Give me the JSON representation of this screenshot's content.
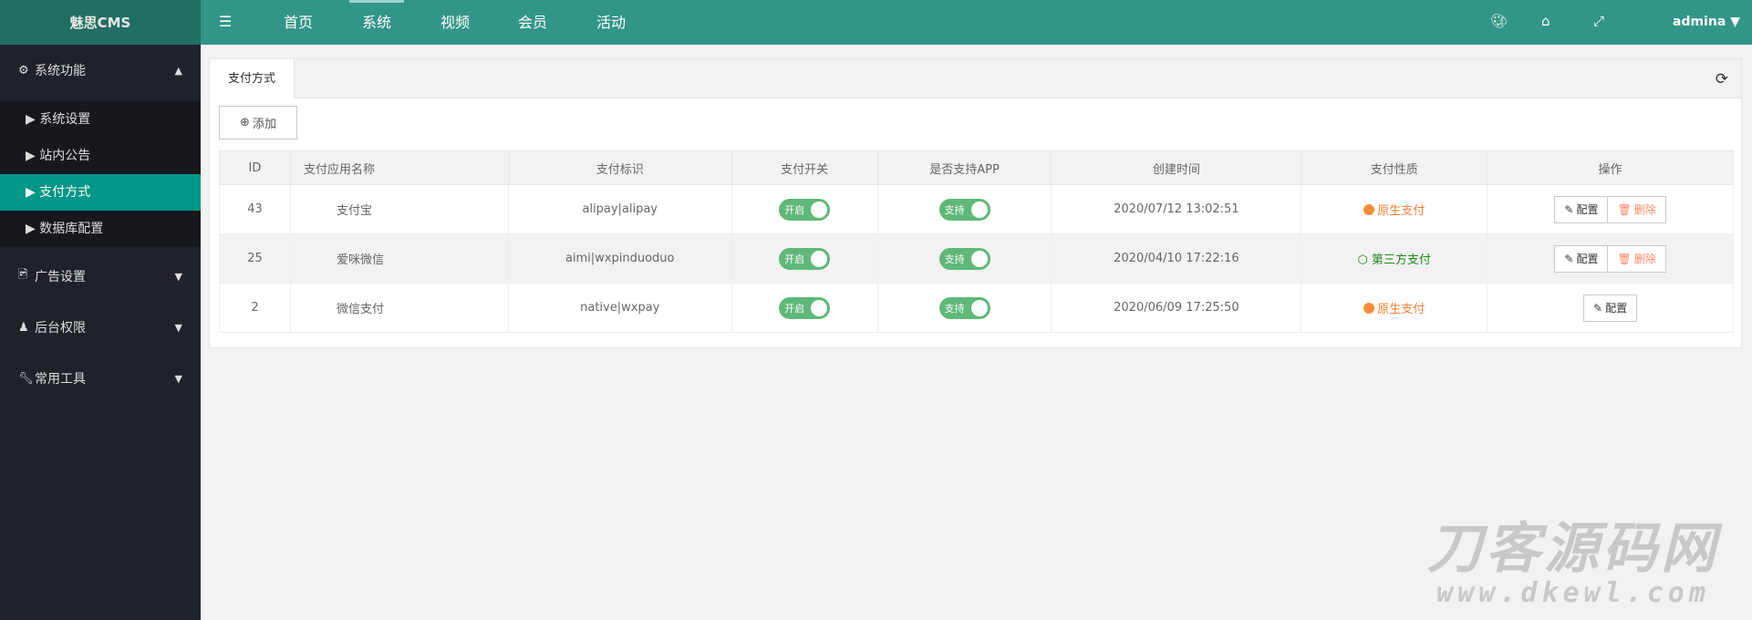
{
  "app": {
    "logo": "魅思CMS"
  },
  "topnav": {
    "items": [
      "首页",
      "系统",
      "视频",
      "会员",
      "活动"
    ],
    "active": "系统",
    "user": "admina",
    "icons": [
      "menu-fold-icon",
      "palette-icon",
      "tag-icon",
      "fullscreen-icon"
    ]
  },
  "sidebar": {
    "groups": [
      {
        "label": "系统功能",
        "icon": "gear-icon",
        "expanded": true
      },
      {
        "label": "广告设置",
        "icon": "image-icon",
        "expanded": false
      },
      {
        "label": "后台权限",
        "icon": "user-icon",
        "expanded": false
      },
      {
        "label": "常用工具",
        "icon": "wrench-icon",
        "expanded": false
      }
    ],
    "subitems": [
      "系统设置",
      "站内公告",
      "支付方式",
      "数据库配置"
    ],
    "active": "支付方式"
  },
  "content": {
    "tab": "支付方式",
    "add_label": "添加",
    "columns": [
      "ID",
      "支付应用名称",
      "支付标识",
      "支付开关",
      "是否支持APP",
      "创建时间",
      "支付性质",
      "操作"
    ],
    "rows": [
      {
        "id": "43",
        "name": "支付宝",
        "code": "alipay|alipay",
        "switch": "开启",
        "app": "支持",
        "created": "2020/07/12 13:02:51",
        "kind": "原生支付",
        "kind_type": "native",
        "actions": [
          "配置",
          "删除"
        ]
      },
      {
        "id": "25",
        "name": "爱咪微信",
        "code": "aimi|wxpinduoduo",
        "switch": "开启",
        "app": "支持",
        "created": "2020/04/10 17:22:16",
        "kind": "第三方支付",
        "kind_type": "third",
        "actions": [
          "配置",
          "删除"
        ]
      },
      {
        "id": "2",
        "name": "微信支付",
        "code": "native|wxpay",
        "switch": "开启",
        "app": "支持",
        "created": "2020/06/09 17:25:50",
        "kind": "原生支付",
        "kind_type": "native",
        "actions": [
          "配置"
        ]
      }
    ]
  },
  "watermark": {
    "line1": "刀客源码网",
    "line2": "www.dkewl.com"
  },
  "colors": {
    "header": "#319687",
    "logo_bg": "#216e63",
    "sidebar": "#20222a",
    "active": "#009688",
    "switch": "#5fb878",
    "native": "#ff7e35",
    "third": "#1a8a1a"
  }
}
